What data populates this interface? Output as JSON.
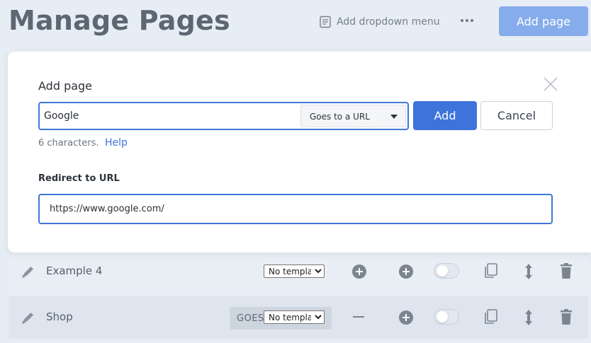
{
  "header": {
    "title": "Manage Pages",
    "add_dropdown_label": "Add dropdown menu",
    "more_icon": "ellipsis-icon",
    "add_page_label": "Add page"
  },
  "modal": {
    "title": "Add page",
    "name_value": "Google",
    "type_selected": "Goes to a URL",
    "add_label": "Add",
    "cancel_label": "Cancel",
    "char_count": "6 characters.",
    "help_label": "Help",
    "url_label": "Redirect to URL",
    "url_value": "https://www.google.com/"
  },
  "rows": [
    {
      "label": "Example 4",
      "template": "No template"
    },
    {
      "label": "Shop",
      "badge": "GOES",
      "template": "No template"
    }
  ],
  "colors": {
    "accent": "#3f73dc",
    "accent_light": "#87acec",
    "background": "#e7edf4"
  }
}
